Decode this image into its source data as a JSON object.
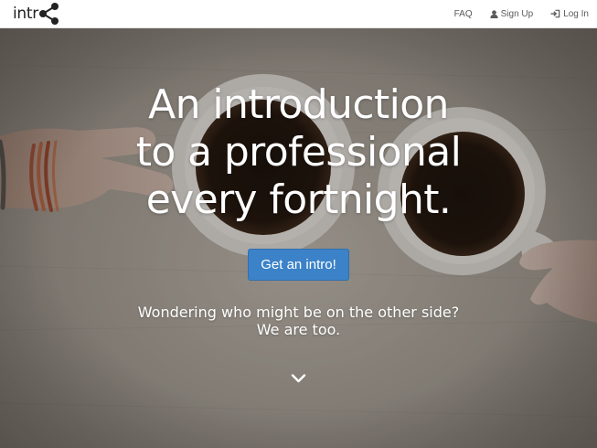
{
  "brand": {
    "name": "intr",
    "logo_icon": "network-nodes-icon"
  },
  "nav": {
    "items": [
      {
        "label": "FAQ",
        "icon": ""
      },
      {
        "label": "Sign Up",
        "icon": "user-icon"
      },
      {
        "label": "Log In",
        "icon": "sign-in-icon"
      }
    ]
  },
  "hero": {
    "headline": [
      "An introduction",
      "to a professional",
      "every fortnight."
    ],
    "cta_label": "Get an intro!",
    "subline": [
      "Wondering who might be on the other side?",
      "We are too."
    ],
    "scroll_icon": "chevron-down-icon"
  },
  "colors": {
    "accent": "#3b82c8",
    "nav_text": "#5a5a5a",
    "hero_text": "#ffffff"
  }
}
